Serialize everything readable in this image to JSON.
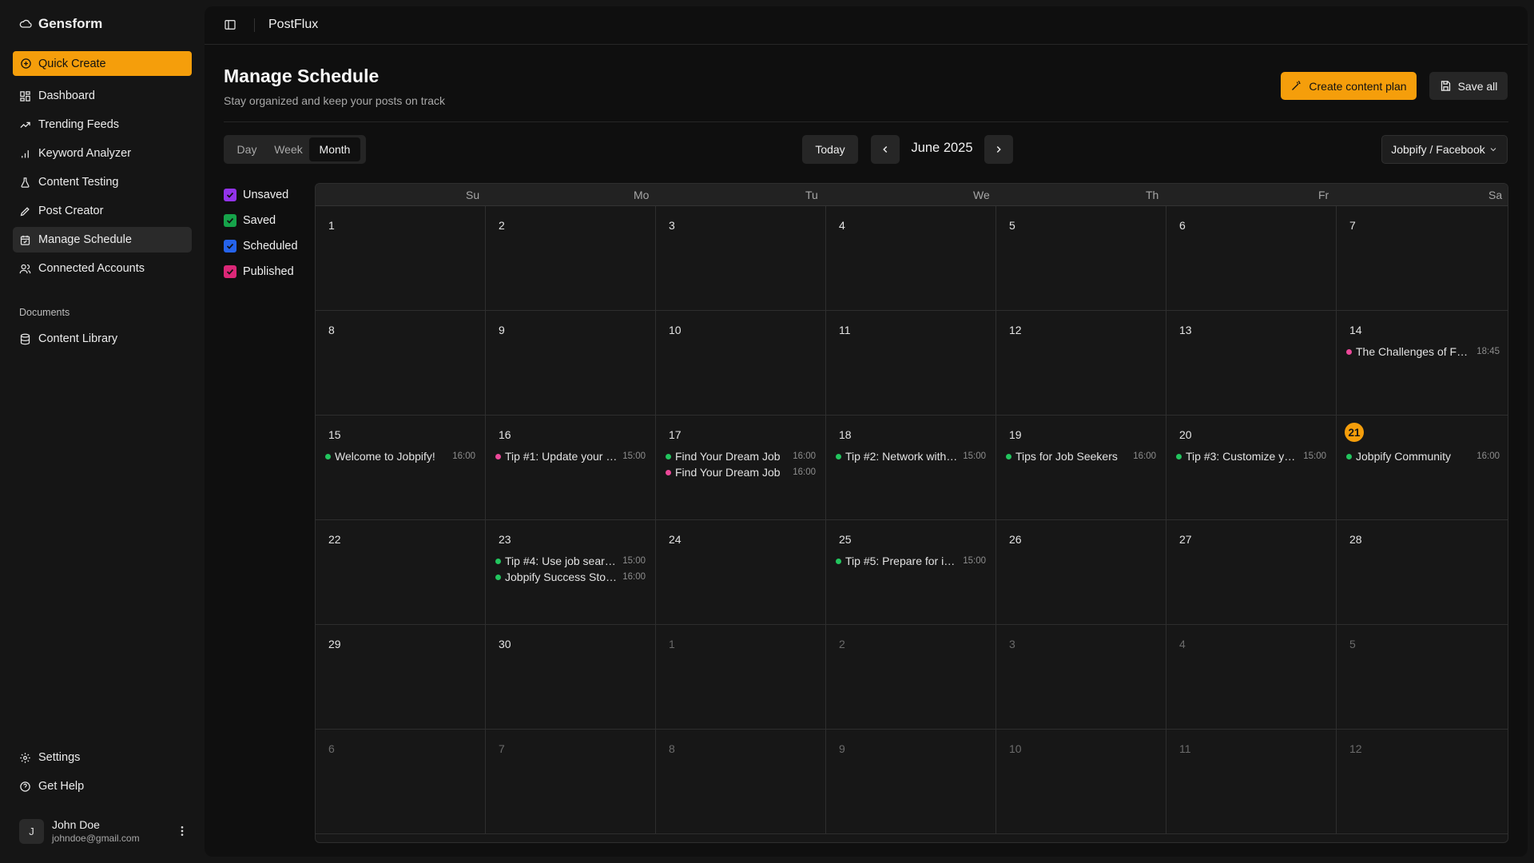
{
  "sidebar": {
    "brand": "Gensform",
    "quick_create": "Quick Create",
    "items": [
      {
        "label": "Dashboard",
        "icon": "dashboard-icon"
      },
      {
        "label": "Trending Feeds",
        "icon": "trending-up-icon"
      },
      {
        "label": "Keyword Analyzer",
        "icon": "bar-chart-icon"
      },
      {
        "label": "Content Testing",
        "icon": "flask-icon"
      },
      {
        "label": "Post Creator",
        "icon": "pencil-icon"
      },
      {
        "label": "Manage Schedule",
        "icon": "calendar-icon",
        "active": true
      },
      {
        "label": "Connected Accounts",
        "icon": "users-icon"
      }
    ],
    "documents_label": "Documents",
    "documents": [
      {
        "label": "Content Library",
        "icon": "database-icon"
      }
    ],
    "bottom": [
      {
        "label": "Settings",
        "icon": "gear-icon"
      },
      {
        "label": "Get Help",
        "icon": "help-circle-icon"
      }
    ],
    "user": {
      "initial": "J",
      "name": "John Doe",
      "email": "johndoe@gmail.com"
    }
  },
  "header": {
    "app_title": "PostFlux"
  },
  "page": {
    "title": "Manage Schedule",
    "subtitle": "Stay organized and keep your posts on track",
    "create_plan_label": "Create content plan",
    "save_all_label": "Save all"
  },
  "toolbar": {
    "views": [
      "Day",
      "Week",
      "Month"
    ],
    "active_view": "Month",
    "today_label": "Today",
    "month_label": "June 2025",
    "account": "Jobpify / Facebook"
  },
  "legend": [
    {
      "label": "Unsaved",
      "color": "#9333ea"
    },
    {
      "label": "Saved",
      "color": "#16a34a"
    },
    {
      "label": "Scheduled",
      "color": "#2563eb"
    },
    {
      "label": "Published",
      "color": "#db2777"
    }
  ],
  "calendar": {
    "weekdays": [
      "Su",
      "Mo",
      "Tu",
      "We",
      "Th",
      "Fr",
      "Sa"
    ],
    "today": 21,
    "weeks": [
      [
        {
          "d": "1"
        },
        {
          "d": "2"
        },
        {
          "d": "3"
        },
        {
          "d": "4"
        },
        {
          "d": "5"
        },
        {
          "d": "6"
        },
        {
          "d": "7"
        }
      ],
      [
        {
          "d": "8"
        },
        {
          "d": "9"
        },
        {
          "d": "10"
        },
        {
          "d": "11"
        },
        {
          "d": "12"
        },
        {
          "d": "13"
        },
        {
          "d": "14",
          "events": [
            {
              "title": "The Challenges of F…",
              "time": "18:45",
              "color": "#ec4899"
            }
          ]
        }
      ],
      [
        {
          "d": "15",
          "events": [
            {
              "title": "Welcome to Jobpify!",
              "time": "16:00",
              "color": "#22c55e"
            }
          ]
        },
        {
          "d": "16",
          "events": [
            {
              "title": "Tip #1: Update your …",
              "time": "15:00",
              "color": "#ec4899"
            }
          ]
        },
        {
          "d": "17",
          "events": [
            {
              "title": "Find Your Dream Job",
              "time": "16:00",
              "color": "#22c55e"
            },
            {
              "title": "Find Your Dream Job",
              "time": "16:00",
              "color": "#ec4899"
            }
          ]
        },
        {
          "d": "18",
          "events": [
            {
              "title": "Tip #2: Network with…",
              "time": "15:00",
              "color": "#22c55e"
            }
          ]
        },
        {
          "d": "19",
          "events": [
            {
              "title": "Tips for Job Seekers",
              "time": "16:00",
              "color": "#22c55e"
            }
          ]
        },
        {
          "d": "20",
          "events": [
            {
              "title": "Tip #3: Customize y…",
              "time": "15:00",
              "color": "#22c55e"
            }
          ]
        },
        {
          "d": "21",
          "today": true,
          "events": [
            {
              "title": "Jobpify Community",
              "time": "16:00",
              "color": "#22c55e"
            }
          ]
        }
      ],
      [
        {
          "d": "22"
        },
        {
          "d": "23",
          "events": [
            {
              "title": "Tip #4: Use job sear…",
              "time": "15:00",
              "color": "#22c55e"
            },
            {
              "title": "Jobpify Success Sto…",
              "time": "16:00",
              "color": "#22c55e"
            }
          ]
        },
        {
          "d": "24"
        },
        {
          "d": "25",
          "events": [
            {
              "title": "Tip #5: Prepare for i…",
              "time": "15:00",
              "color": "#22c55e"
            }
          ]
        },
        {
          "d": "26"
        },
        {
          "d": "27"
        },
        {
          "d": "28"
        }
      ],
      [
        {
          "d": "29"
        },
        {
          "d": "30"
        },
        {
          "d": "1",
          "outside": true
        },
        {
          "d": "2",
          "outside": true
        },
        {
          "d": "3",
          "outside": true
        },
        {
          "d": "4",
          "outside": true
        },
        {
          "d": "5",
          "outside": true
        }
      ],
      [
        {
          "d": "6",
          "outside": true
        },
        {
          "d": "7",
          "outside": true
        },
        {
          "d": "8",
          "outside": true
        },
        {
          "d": "9",
          "outside": true
        },
        {
          "d": "10",
          "outside": true
        },
        {
          "d": "11",
          "outside": true
        },
        {
          "d": "12",
          "outside": true
        }
      ]
    ]
  }
}
